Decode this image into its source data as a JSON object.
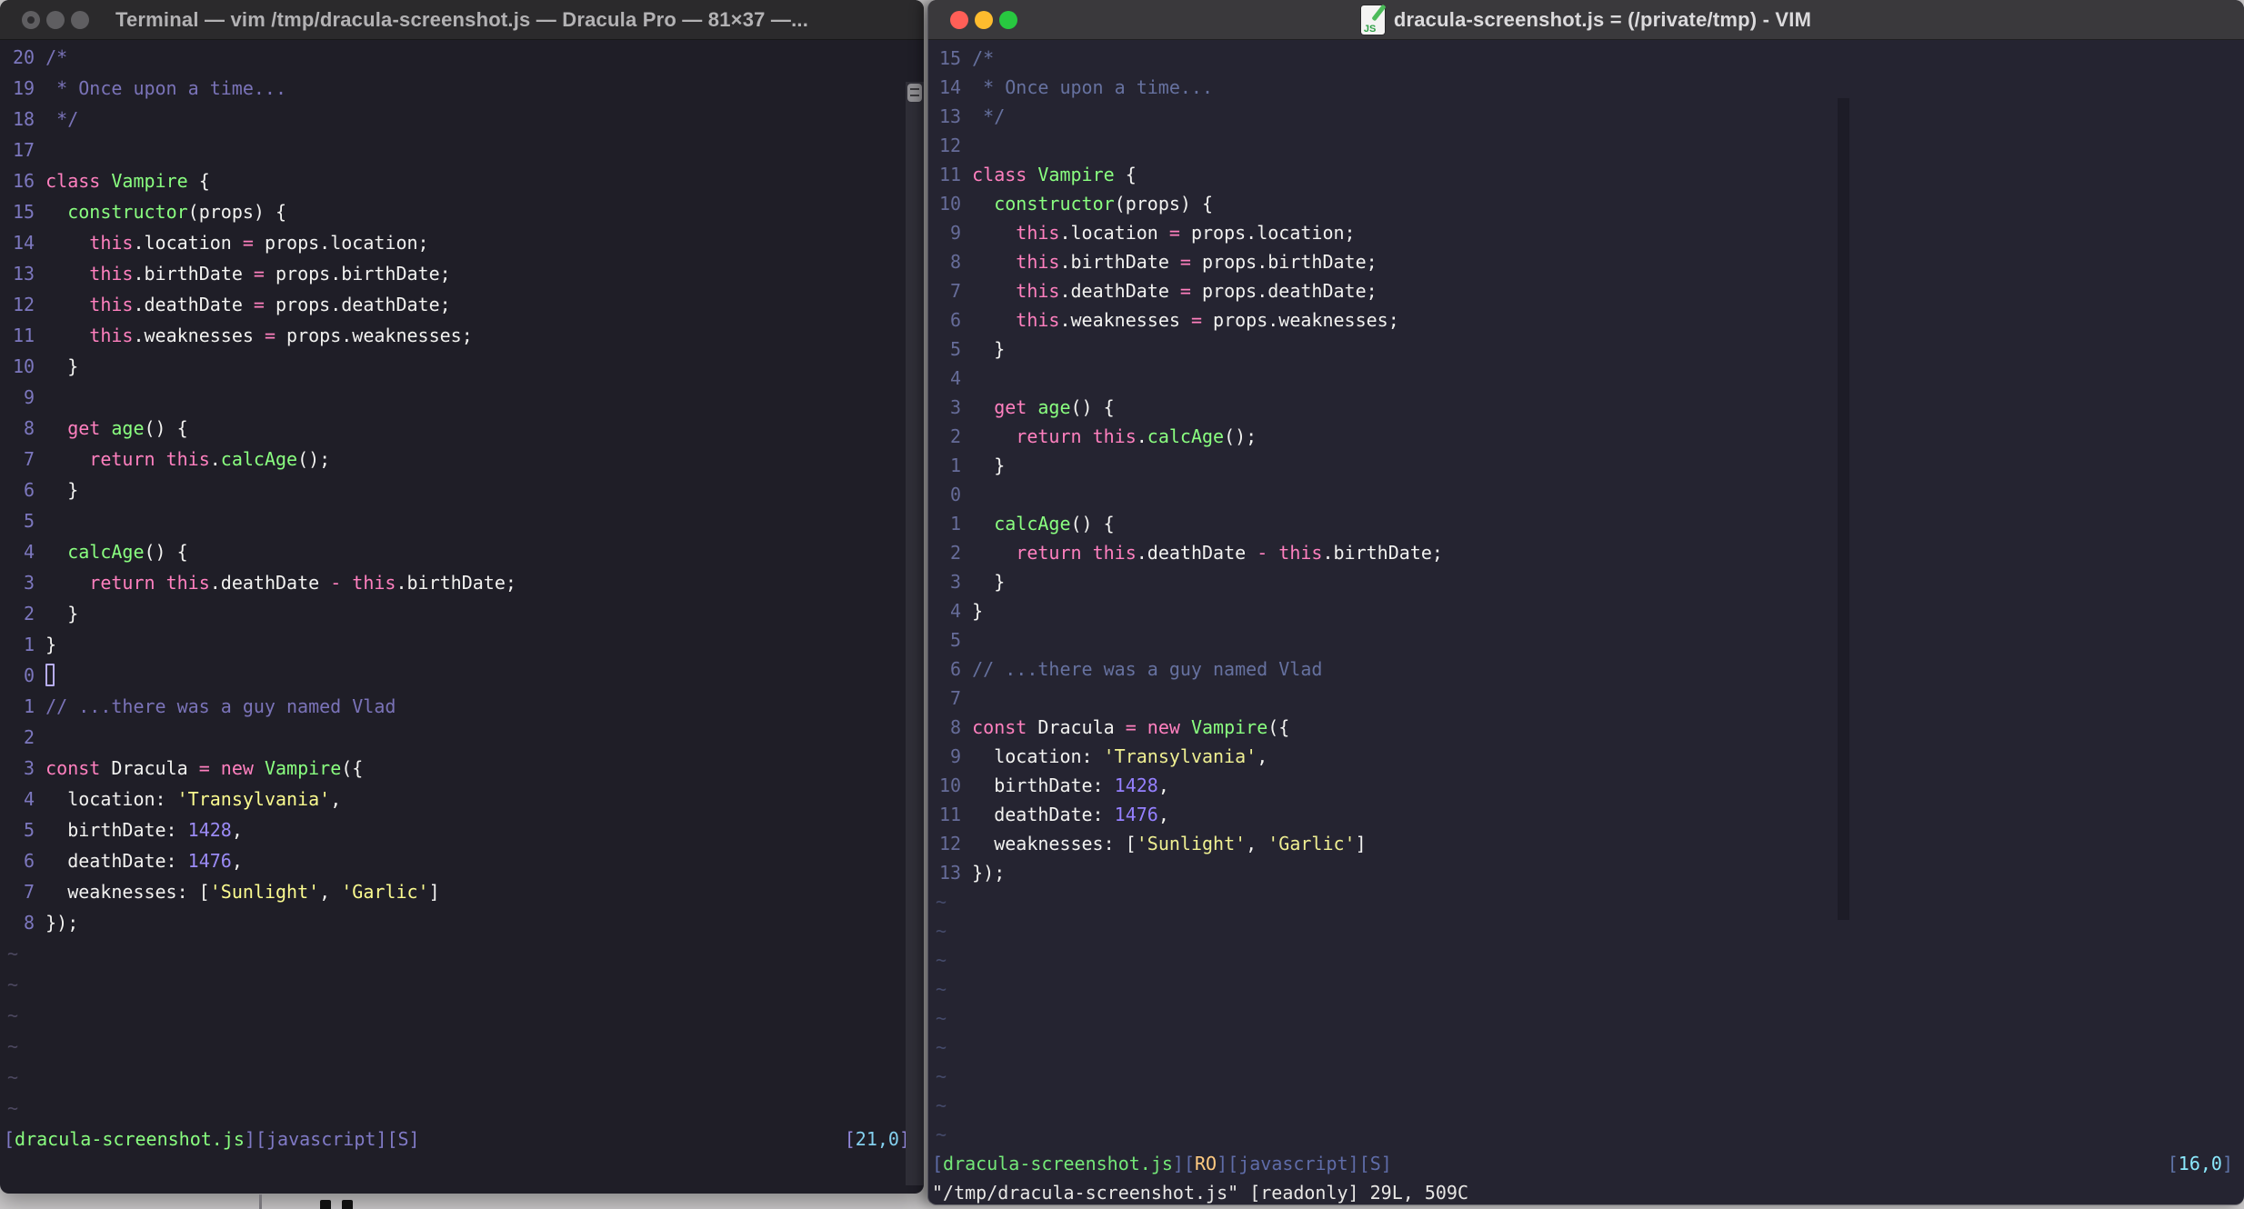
{
  "left_window": {
    "title": "Terminal — vim /tmp/dracula-screenshot.js — Dracula Pro — 81×37 —...",
    "cmdline": "",
    "tilde": "~",
    "tilde_rows": 6,
    "palette": {
      "bg": "#1F1E27",
      "tb": "#2B2A2C",
      "tt": "#B3B2B4",
      "gut": "#7C77BE",
      "com": "#7A73B8",
      "kw": "#FF80BF",
      "fn": "#8AFF80",
      "fg": "#F2F2F0",
      "str": "#FBFB8F",
      "num": "#9B8BF5",
      "til": "#4C4860",
      "sb": "#807AC6",
      "sf": "#8AFF80",
      "ro": "#FFCA80",
      "rb": "#9388DD",
      "rt": "#84D1EF",
      "cmd": "#E8E7E5",
      "cur": "#B7ADF2"
    },
    "status": {
      "segs": [
        [
          "b",
          "["
        ],
        [
          "g",
          "dracula-screenshot.js"
        ],
        [
          "b",
          "]["
        ],
        [
          "b",
          "javascript"
        ],
        [
          "b",
          "][S]"
        ]
      ],
      "ruler": [
        [
          "rb",
          "["
        ],
        [
          "y",
          "21,0"
        ],
        [
          "rb",
          "]"
        ]
      ]
    },
    "lines": [
      {
        "n": "20",
        "segs": [
          [
            "c",
            "/*"
          ]
        ]
      },
      {
        "n": "19",
        "segs": [
          [
            "c",
            " * Once upon a time..."
          ]
        ]
      },
      {
        "n": "18",
        "segs": [
          [
            "c",
            " */"
          ]
        ]
      },
      {
        "n": "17",
        "segs": []
      },
      {
        "n": "16",
        "segs": [
          [
            "k",
            "class"
          ],
          [
            "d",
            " "
          ],
          [
            "f",
            "Vampire"
          ],
          [
            "d",
            " {"
          ]
        ]
      },
      {
        "n": "15",
        "segs": [
          [
            "d",
            "  "
          ],
          [
            "f",
            "constructor"
          ],
          [
            "d",
            "(props) {"
          ]
        ]
      },
      {
        "n": "14",
        "segs": [
          [
            "d",
            "    "
          ],
          [
            "k",
            "this"
          ],
          [
            "d",
            ".location "
          ],
          [
            "o",
            "="
          ],
          [
            "d",
            " props.location;"
          ]
        ]
      },
      {
        "n": "13",
        "segs": [
          [
            "d",
            "    "
          ],
          [
            "k",
            "this"
          ],
          [
            "d",
            ".birthDate "
          ],
          [
            "o",
            "="
          ],
          [
            "d",
            " props.birthDate;"
          ]
        ]
      },
      {
        "n": "12",
        "segs": [
          [
            "d",
            "    "
          ],
          [
            "k",
            "this"
          ],
          [
            "d",
            ".deathDate "
          ],
          [
            "o",
            "="
          ],
          [
            "d",
            " props.deathDate;"
          ]
        ]
      },
      {
        "n": "11",
        "segs": [
          [
            "d",
            "    "
          ],
          [
            "k",
            "this"
          ],
          [
            "d",
            ".weaknesses "
          ],
          [
            "o",
            "="
          ],
          [
            "d",
            " props.weaknesses;"
          ]
        ]
      },
      {
        "n": "10",
        "segs": [
          [
            "d",
            "  }"
          ]
        ]
      },
      {
        "n": "9",
        "segs": []
      },
      {
        "n": "8",
        "segs": [
          [
            "d",
            "  "
          ],
          [
            "k",
            "get"
          ],
          [
            "d",
            " "
          ],
          [
            "f",
            "age"
          ],
          [
            "d",
            "() {"
          ]
        ]
      },
      {
        "n": "7",
        "segs": [
          [
            "d",
            "    "
          ],
          [
            "k",
            "return"
          ],
          [
            "d",
            " "
          ],
          [
            "k",
            "this"
          ],
          [
            "d",
            "."
          ],
          [
            "f",
            "calcAge"
          ],
          [
            "d",
            "();"
          ]
        ]
      },
      {
        "n": "6",
        "segs": [
          [
            "d",
            "  }"
          ]
        ]
      },
      {
        "n": "5",
        "segs": []
      },
      {
        "n": "4",
        "segs": [
          [
            "d",
            "  "
          ],
          [
            "f",
            "calcAge"
          ],
          [
            "d",
            "() {"
          ]
        ]
      },
      {
        "n": "3",
        "segs": [
          [
            "d",
            "    "
          ],
          [
            "k",
            "return"
          ],
          [
            "d",
            " "
          ],
          [
            "k",
            "this"
          ],
          [
            "d",
            ".deathDate "
          ],
          [
            "o",
            "-"
          ],
          [
            "d",
            " "
          ],
          [
            "k",
            "this"
          ],
          [
            "d",
            ".birthDate;"
          ]
        ]
      },
      {
        "n": "2",
        "segs": [
          [
            "d",
            "  }"
          ]
        ]
      },
      {
        "n": "1",
        "segs": [
          [
            "d",
            "}"
          ]
        ]
      },
      {
        "n": "0",
        "segs": [],
        "cursor": true
      },
      {
        "n": "1",
        "segs": [
          [
            "c",
            "// ...there was a guy named Vlad"
          ]
        ]
      },
      {
        "n": "2",
        "segs": []
      },
      {
        "n": "3",
        "segs": [
          [
            "k",
            "const"
          ],
          [
            "d",
            " Dracula "
          ],
          [
            "o",
            "="
          ],
          [
            "d",
            " "
          ],
          [
            "k",
            "new"
          ],
          [
            "d",
            " "
          ],
          [
            "f",
            "Vampire"
          ],
          [
            "d",
            "({"
          ]
        ]
      },
      {
        "n": "4",
        "segs": [
          [
            "d",
            "  location: "
          ],
          [
            "s",
            "'Transylvania'"
          ],
          [
            "d",
            ","
          ]
        ]
      },
      {
        "n": "5",
        "segs": [
          [
            "d",
            "  birthDate: "
          ],
          [
            "m",
            "1428"
          ],
          [
            "d",
            ","
          ]
        ]
      },
      {
        "n": "6",
        "segs": [
          [
            "d",
            "  deathDate: "
          ],
          [
            "m",
            "1476"
          ],
          [
            "d",
            ","
          ]
        ]
      },
      {
        "n": "7",
        "segs": [
          [
            "d",
            "  weaknesses: ["
          ],
          [
            "s",
            "'Sunlight'"
          ],
          [
            "d",
            ", "
          ],
          [
            "s",
            "'Garlic'"
          ],
          [
            "d",
            "]"
          ]
        ]
      },
      {
        "n": "8",
        "segs": [
          [
            "d",
            "});"
          ]
        ]
      }
    ]
  },
  "right_window": {
    "title": "dracula-screenshot.js = (/private/tmp) - VIM",
    "doc_icon_label": "JS",
    "cmdline": "\"/tmp/dracula-screenshot.js\" [readonly] 29L, 509C",
    "tilde": "~",
    "tilde_rows": 9,
    "traffic_colors": [
      "#FF5F57",
      "#FEBC2E",
      "#28C840"
    ],
    "palette": {
      "bg": "#252431",
      "tb": "#3A393C",
      "tt": "#DBDADC",
      "gut": "#666C99",
      "com": "#66719F",
      "kw": "#FF80BF",
      "fn": "#8AFF80",
      "fg": "#F2F2F0",
      "str": "#EFEF92",
      "num": "#9580FF",
      "til": "#444A6A",
      "sb": "#5F6CA8",
      "sf": "#74E878",
      "ro": "#FFCA80",
      "rb": "#5F74A8",
      "rt": "#8BE9FD",
      "cmd": "#E8E7E5",
      "cur": "#B7ADF2"
    },
    "status": {
      "segs": [
        [
          "b",
          "["
        ],
        [
          "g",
          "dracula-screenshot.js"
        ],
        [
          "b",
          "]["
        ],
        [
          "r",
          "RO"
        ],
        [
          "b",
          "]["
        ],
        [
          "b",
          "javascript"
        ],
        [
          "b",
          "][S]"
        ]
      ],
      "ruler": [
        [
          "rb",
          "["
        ],
        [
          "y",
          "16,0"
        ],
        [
          "rb",
          "]"
        ]
      ]
    },
    "lines": [
      {
        "n": "15",
        "segs": [
          [
            "c",
            "/*"
          ]
        ]
      },
      {
        "n": "14",
        "segs": [
          [
            "c",
            " * Once upon a time..."
          ]
        ]
      },
      {
        "n": "13",
        "segs": [
          [
            "c",
            " */"
          ]
        ]
      },
      {
        "n": "12",
        "segs": []
      },
      {
        "n": "11",
        "segs": [
          [
            "k",
            "class"
          ],
          [
            "d",
            " "
          ],
          [
            "f",
            "Vampire"
          ],
          [
            "d",
            " {"
          ]
        ]
      },
      {
        "n": "10",
        "segs": [
          [
            "d",
            "  "
          ],
          [
            "f",
            "constructor"
          ],
          [
            "d",
            "(props) {"
          ]
        ]
      },
      {
        "n": "9",
        "segs": [
          [
            "d",
            "    "
          ],
          [
            "k",
            "this"
          ],
          [
            "d",
            ".location "
          ],
          [
            "o",
            "="
          ],
          [
            "d",
            " props.location;"
          ]
        ]
      },
      {
        "n": "8",
        "segs": [
          [
            "d",
            "    "
          ],
          [
            "k",
            "this"
          ],
          [
            "d",
            ".birthDate "
          ],
          [
            "o",
            "="
          ],
          [
            "d",
            " props.birthDate;"
          ]
        ]
      },
      {
        "n": "7",
        "segs": [
          [
            "d",
            "    "
          ],
          [
            "k",
            "this"
          ],
          [
            "d",
            ".deathDate "
          ],
          [
            "o",
            "="
          ],
          [
            "d",
            " props.deathDate;"
          ]
        ]
      },
      {
        "n": "6",
        "segs": [
          [
            "d",
            "    "
          ],
          [
            "k",
            "this"
          ],
          [
            "d",
            ".weaknesses "
          ],
          [
            "o",
            "="
          ],
          [
            "d",
            " props.weaknesses;"
          ]
        ]
      },
      {
        "n": "5",
        "segs": [
          [
            "d",
            "  }"
          ]
        ]
      },
      {
        "n": "4",
        "segs": []
      },
      {
        "n": "3",
        "segs": [
          [
            "d",
            "  "
          ],
          [
            "k",
            "get"
          ],
          [
            "d",
            " "
          ],
          [
            "f",
            "age"
          ],
          [
            "d",
            "() {"
          ]
        ]
      },
      {
        "n": "2",
        "segs": [
          [
            "d",
            "    "
          ],
          [
            "k",
            "return"
          ],
          [
            "d",
            " "
          ],
          [
            "k",
            "this"
          ],
          [
            "d",
            "."
          ],
          [
            "f",
            "calcAge"
          ],
          [
            "d",
            "();"
          ]
        ]
      },
      {
        "n": "1",
        "segs": [
          [
            "d",
            "  }"
          ]
        ]
      },
      {
        "n": "0",
        "segs": []
      },
      {
        "n": "1",
        "segs": [
          [
            "d",
            "  "
          ],
          [
            "f",
            "calcAge"
          ],
          [
            "d",
            "() {"
          ]
        ]
      },
      {
        "n": "2",
        "segs": [
          [
            "d",
            "    "
          ],
          [
            "k",
            "return"
          ],
          [
            "d",
            " "
          ],
          [
            "k",
            "this"
          ],
          [
            "d",
            ".deathDate "
          ],
          [
            "o",
            "-"
          ],
          [
            "d",
            " "
          ],
          [
            "k",
            "this"
          ],
          [
            "d",
            ".birthDate;"
          ]
        ]
      },
      {
        "n": "3",
        "segs": [
          [
            "d",
            "  }"
          ]
        ]
      },
      {
        "n": "4",
        "segs": [
          [
            "d",
            "}"
          ]
        ]
      },
      {
        "n": "5",
        "segs": []
      },
      {
        "n": "6",
        "segs": [
          [
            "c",
            "// ...there was a guy named Vlad"
          ]
        ]
      },
      {
        "n": "7",
        "segs": []
      },
      {
        "n": "8",
        "segs": [
          [
            "k",
            "const"
          ],
          [
            "d",
            " Dracula "
          ],
          [
            "o",
            "="
          ],
          [
            "d",
            " "
          ],
          [
            "k",
            "new"
          ],
          [
            "d",
            " "
          ],
          [
            "f",
            "Vampire"
          ],
          [
            "d",
            "({"
          ]
        ]
      },
      {
        "n": "9",
        "segs": [
          [
            "d",
            "  location: "
          ],
          [
            "s",
            "'Transylvania'"
          ],
          [
            "d",
            ","
          ]
        ]
      },
      {
        "n": "10",
        "segs": [
          [
            "d",
            "  birthDate: "
          ],
          [
            "m",
            "1428"
          ],
          [
            "d",
            ","
          ]
        ]
      },
      {
        "n": "11",
        "segs": [
          [
            "d",
            "  deathDate: "
          ],
          [
            "m",
            "1476"
          ],
          [
            "d",
            ","
          ]
        ]
      },
      {
        "n": "12",
        "segs": [
          [
            "d",
            "  weaknesses: ["
          ],
          [
            "s",
            "'Sunlight'"
          ],
          [
            "d",
            ", "
          ],
          [
            "s",
            "'Garlic'"
          ],
          [
            "d",
            "]"
          ]
        ]
      },
      {
        "n": "13",
        "segs": [
          [
            "d",
            "});"
          ]
        ]
      }
    ]
  }
}
